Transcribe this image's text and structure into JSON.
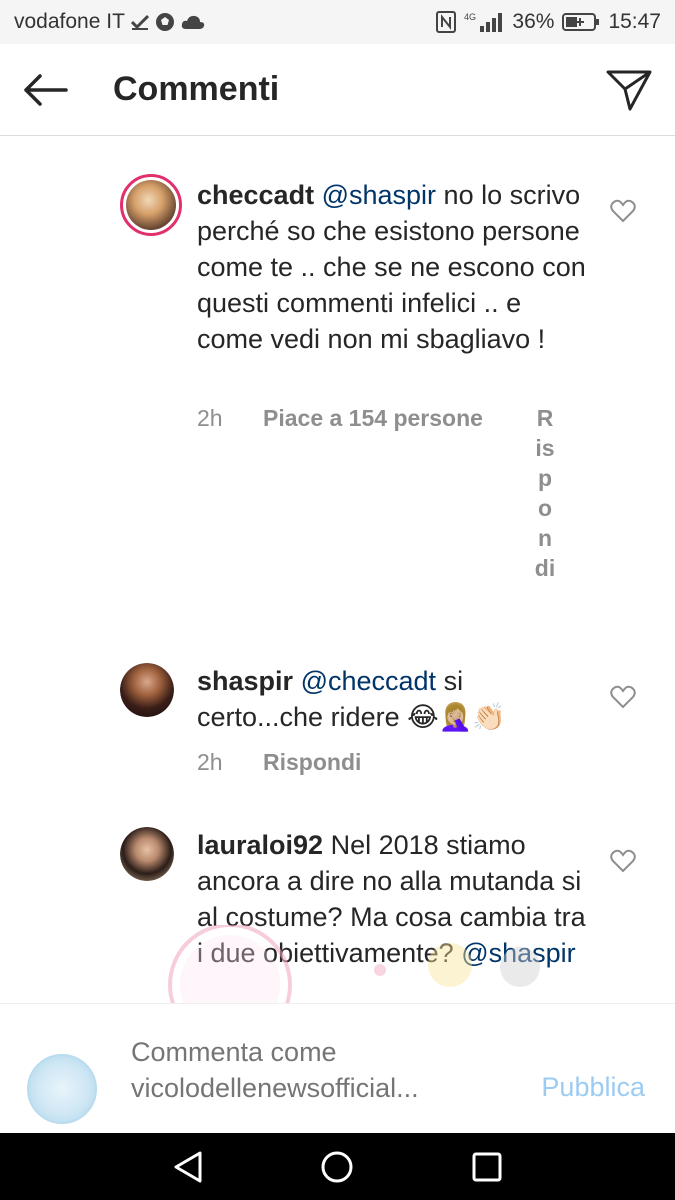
{
  "statusbar": {
    "carrier": "vodafone IT",
    "network": "4G",
    "battery": "36%",
    "time": "15:47"
  },
  "header": {
    "title": "Commenti",
    "back_icon": "arrow-left-icon",
    "send_icon": "paper-plane-icon"
  },
  "comments": [
    {
      "username": "checcadt",
      "mention": "@shaspir",
      "text": "no lo scrivo perché so che esistono persone come te .. che se ne escono con questi commenti infelici .. e come vedi non mi sbagliavo !",
      "time": "2h",
      "likes": "Piace a 154 persone",
      "reply": "Rispondi"
    },
    {
      "username": "shaspir",
      "mention": "@checcadt",
      "text": "si certo...che ridere 😂🤦🏼‍♀️👏🏻",
      "time": "2h",
      "reply": "Rispondi"
    },
    {
      "username": "lauraloi92",
      "text": "Nel 2018 stiamo ancora a dire no alla mutanda si al costume? Ma cosa cambia tra i due obiettivamente?",
      "mention_end": "@shaspir"
    }
  ],
  "input": {
    "placeholder": "Commenta come vicolodellenewsofficial...",
    "publish_label": "Pubblica"
  },
  "colors": {
    "mention": "#003569",
    "meta": "#8e8e8e",
    "publish": "#9ccbf3",
    "navbar": "#000000"
  }
}
